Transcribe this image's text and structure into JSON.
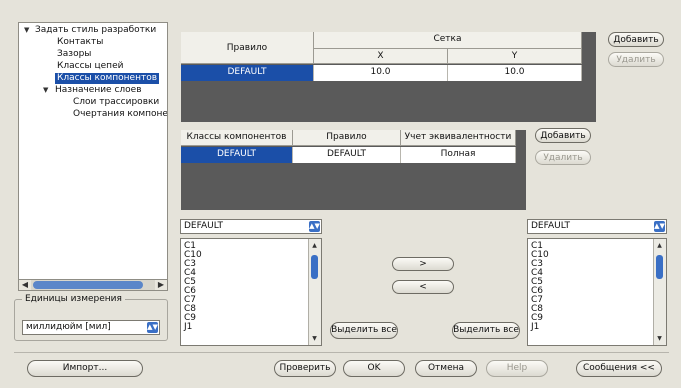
{
  "tree": {
    "root": "Задать стиль разработки",
    "children": [
      "Контакты",
      "Зазоры",
      "Классы цепей",
      "Классы компонентов"
    ],
    "layers": "Назначение слоев",
    "layer_children": [
      "Слои трассировки",
      "Очертания компонен"
    ]
  },
  "units": {
    "group_label": "Единицы измерения",
    "value": "миллидюйм [мил]"
  },
  "rule_grid": {
    "col_rule": "Правило",
    "col_grid": "Сетка",
    "col_x": "X",
    "col_y": "Y",
    "row": {
      "rule": "DEFAULT",
      "x": "10.0",
      "y": "10.0"
    }
  },
  "class_grid": {
    "col_class": "Классы компонентов",
    "col_rule": "Правило",
    "col_equiv": "Учет эквивалентности",
    "row": {
      "class": "DEFAULT",
      "rule": "DEFAULT",
      "equiv": "Полная"
    }
  },
  "buttons": {
    "add": "Добавить",
    "delete": "Удалить",
    "move_right": ">",
    "move_left": "<",
    "select_all": "Выделить все",
    "import": "Импорт...",
    "check": "Проверить",
    "ok": "OK",
    "cancel": "Отмена",
    "help": "Help",
    "messages": "Сообщения <<"
  },
  "left_list": {
    "combo": "DEFAULT",
    "items": [
      "C1",
      "C10",
      "C3",
      "C4",
      "C5",
      "C6",
      "C7",
      "C8",
      "C9",
      "J1"
    ]
  },
  "right_list": {
    "combo": "DEFAULT",
    "items": [
      "C1",
      "C10",
      "C3",
      "C4",
      "C5",
      "C6",
      "C7",
      "C8",
      "C9",
      "J1"
    ]
  }
}
